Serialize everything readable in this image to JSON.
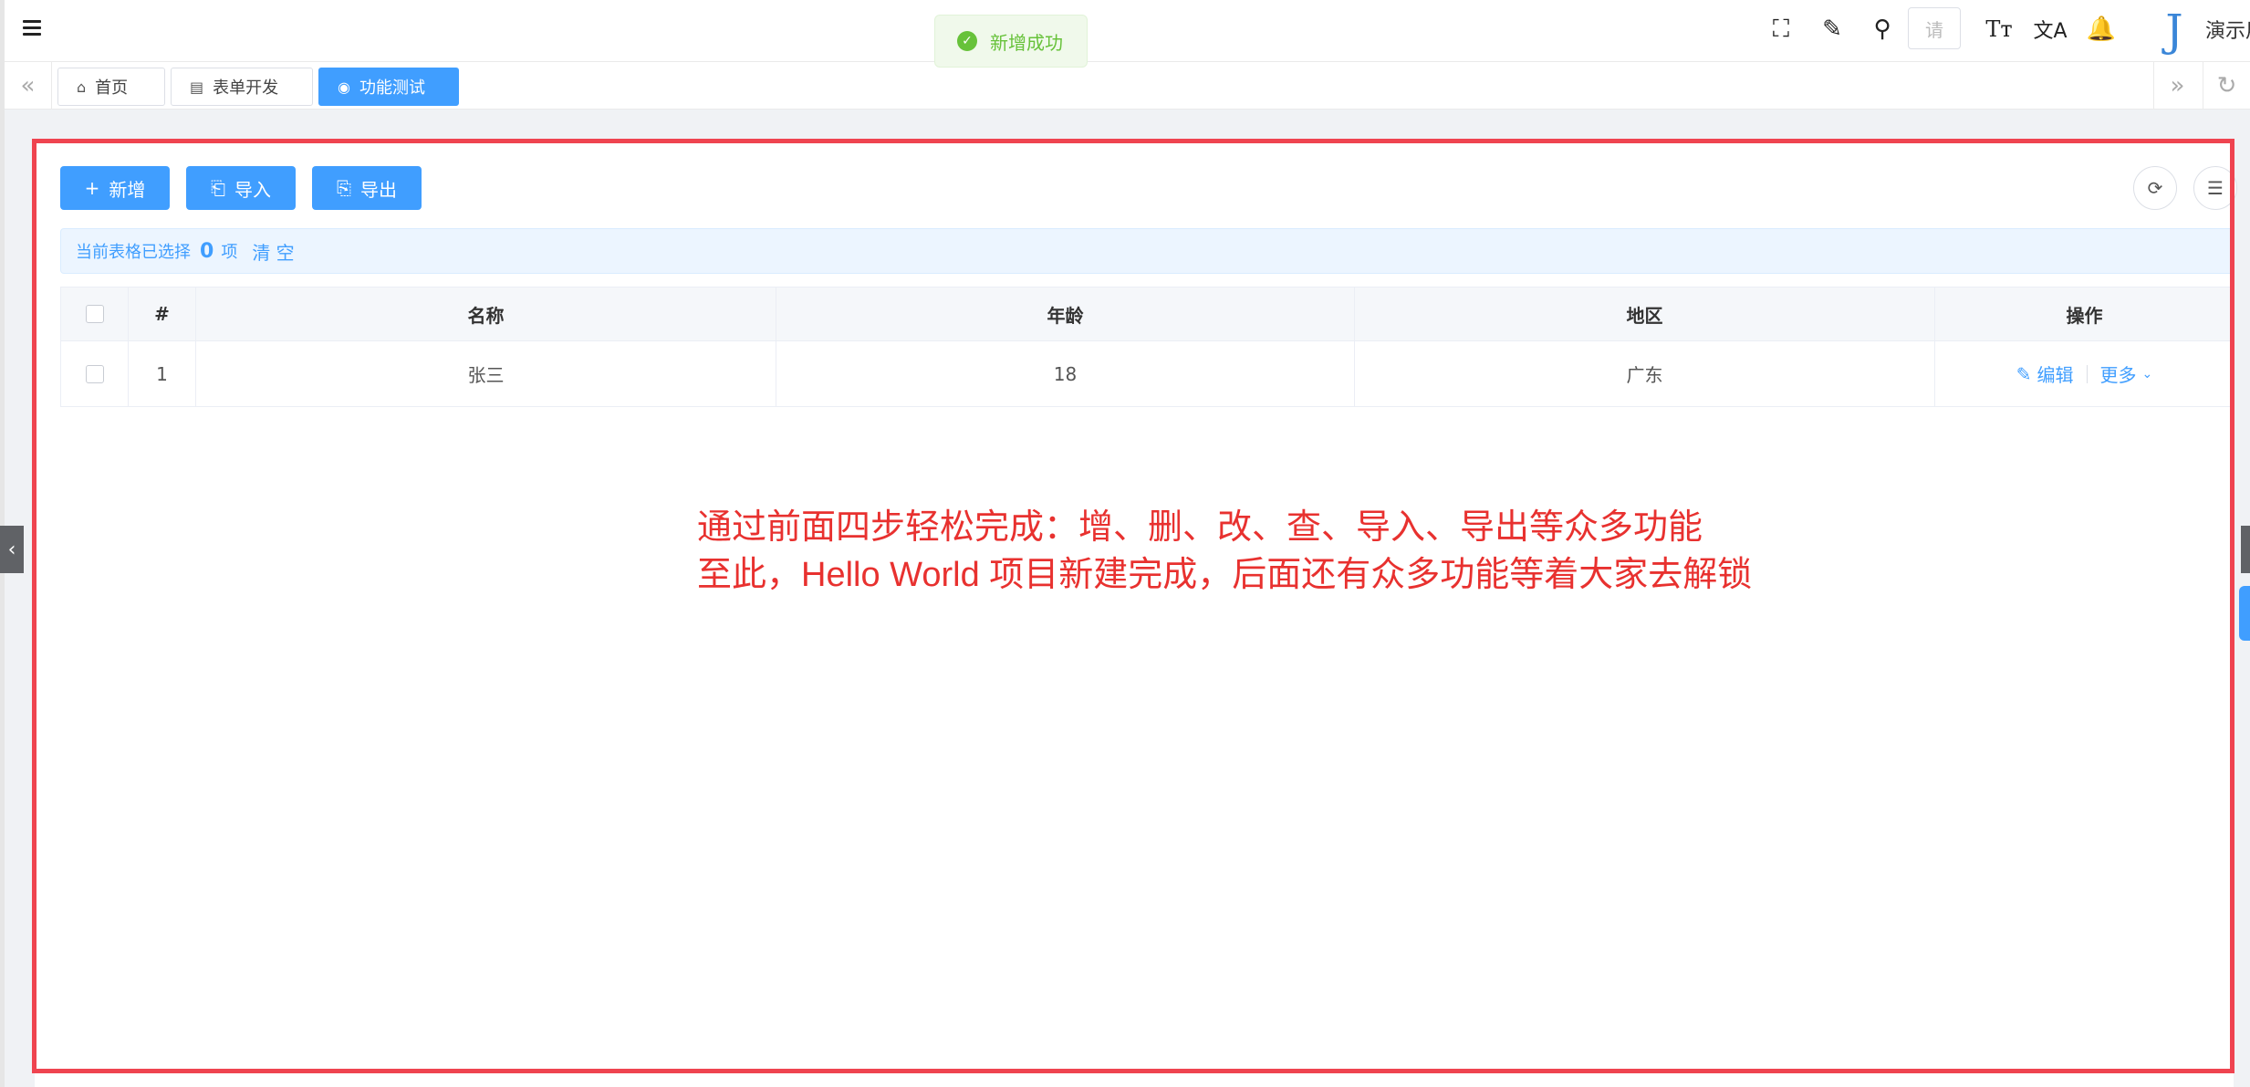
{
  "header": {
    "search_placeholder": "请",
    "user_name": "演示用",
    "avatar_glyph": "J",
    "icons": [
      "menu-fold-icon",
      "fullscreen-icon",
      "clear-cache-icon",
      "search-icon",
      "font-size-icon",
      "translate-icon",
      "bell-icon"
    ]
  },
  "toast": {
    "text": "新增成功",
    "color": "#67c23a"
  },
  "tabs": [
    {
      "label": "首页",
      "icon": "home-icon",
      "active": false
    },
    {
      "label": "表单开发",
      "icon": "form-icon",
      "active": false
    },
    {
      "label": "功能测试",
      "icon": "eye-icon",
      "active": true
    }
  ],
  "toolbar": {
    "add_label": "新增",
    "import_label": "导入",
    "export_label": "导出"
  },
  "selection": {
    "prefix": "当前表格已选择",
    "count": "0",
    "suffix": "项",
    "clear_label": "清 空"
  },
  "table": {
    "columns": [
      "#",
      "名称",
      "年龄",
      "地区",
      "操作"
    ],
    "rows": [
      {
        "index": "1",
        "name": "张三",
        "age": "18",
        "region": "广东"
      }
    ],
    "edit_label": "编辑",
    "more_label": "更多"
  },
  "annotation": {
    "line1": "通过前面四步轻松完成：增、删、改、查、导入、导出等众多功能",
    "line2": "至此，Hello World 项目新建完成，后面还有众多功能等着大家去解锁",
    "color": "#e8312f"
  },
  "colors": {
    "primary": "#409eff",
    "success": "#67c23a",
    "annotation_border": "#ef4450"
  }
}
